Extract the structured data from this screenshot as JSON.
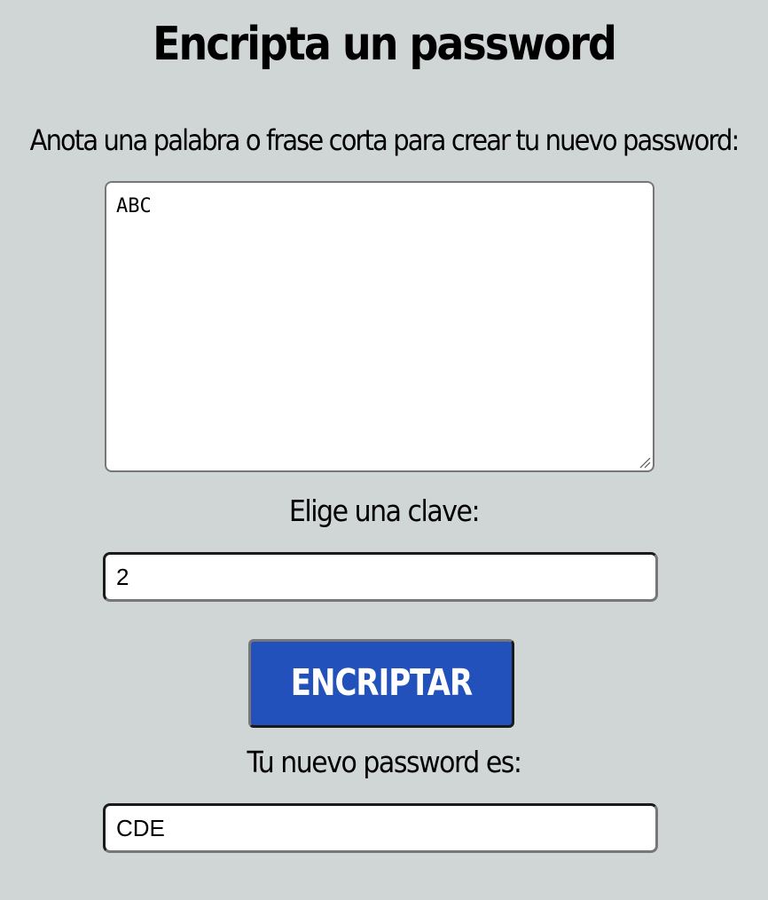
{
  "page": {
    "title": "Encripta un password",
    "background": "#d0d5d6"
  },
  "form": {
    "phrase_label": "Anota una palabra o frase corta para crear tu nuevo password:",
    "phrase_value": "ABC",
    "key_label": "Elige una clave:",
    "key_value": "2",
    "button_label": "ENCRIPTAR",
    "button_color": "#2251bb",
    "result_label": "Tu nuevo password es:",
    "result_value": "CDE"
  },
  "icons": {
    "resize": "resize-handle-icon"
  }
}
